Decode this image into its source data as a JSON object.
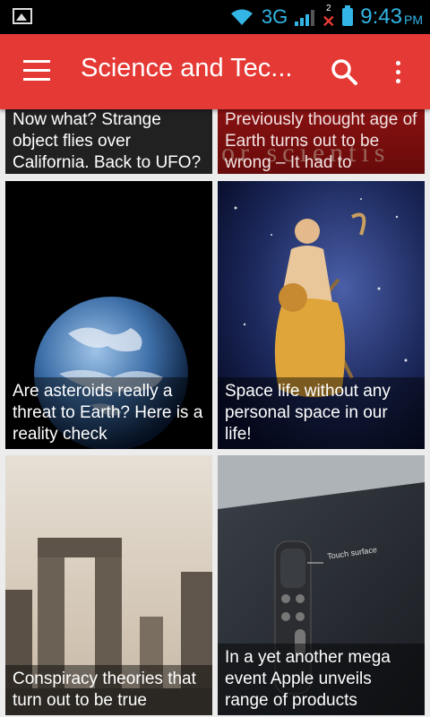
{
  "status": {
    "network": "3G",
    "notification_count": "2",
    "time": "9:43",
    "ampm": "PM"
  },
  "appbar": {
    "title": "Science and Tec..."
  },
  "cards": [
    {
      "title": "Now what? Strange object flies over California. Back to UFO?"
    },
    {
      "title": "Previously thought age of Earth turns out to be wrong – It had to",
      "overlay_text": "or scientis"
    },
    {
      "title": "Are asteroids really a threat to Earth? Here is a reality check"
    },
    {
      "title": "Space life without any personal space in our life!"
    },
    {
      "title": "Conspiracy theories that turn out to be true"
    },
    {
      "title": "In a yet another mega event Apple unveils range of products",
      "overlay_text": "Touch surface"
    }
  ],
  "colors": {
    "accent": "#e53935",
    "status_blue": "#33b5e5"
  }
}
